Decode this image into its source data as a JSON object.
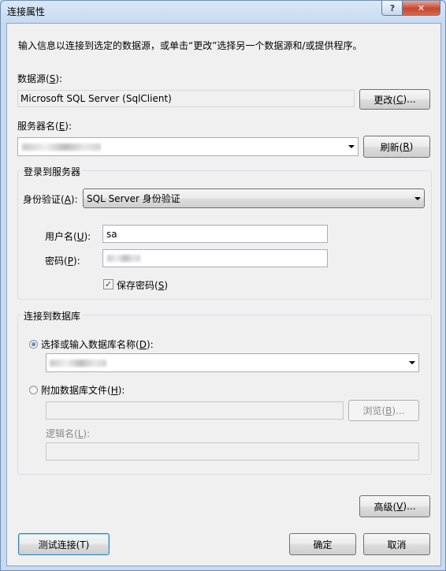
{
  "window": {
    "title": "连接属性",
    "help_label": "?",
    "close_label": "✕"
  },
  "intro_text": "输入信息以连接到选定的数据源，或单击“更改”选择另一个数据源和/或提供程序。",
  "data_source": {
    "label": "数据源(",
    "accel": "S",
    "label_end": "):",
    "value": "Microsoft SQL Server (SqlClient)",
    "change_label": "更改(",
    "change_accel": "C",
    "change_end": ")..."
  },
  "server": {
    "label": "服务器名(",
    "accel": "E",
    "label_end": "):",
    "refresh_label": "刷新(",
    "refresh_accel": "R",
    "refresh_end": ")"
  },
  "login": {
    "group_title": "登录到服务器",
    "auth_label": "身份验证(",
    "auth_accel": "A",
    "auth_end": "):",
    "auth_value": "SQL Server 身份验证",
    "user_label": "用户名(",
    "user_accel": "U",
    "user_end": "):",
    "user_value": "sa",
    "password_label": "密码(",
    "password_accel": "P",
    "password_end": "):",
    "save_password_label": "保存密码(",
    "save_password_accel": "S",
    "save_password_end": ")",
    "save_password_checked": true,
    "check_mark": "✓"
  },
  "database": {
    "group_title": "连接到数据库",
    "select_label": "选择或输入数据库名称(",
    "select_accel": "D",
    "select_end": "):",
    "select_checked": true,
    "attach_label": "附加数据库文件(",
    "attach_accel": "H",
    "attach_end": "):",
    "attach_checked": false,
    "browse_label": "浏览(",
    "browse_accel": "B",
    "browse_end": ")...",
    "logical_label": "逻辑名(",
    "logical_accel": "L",
    "logical_end": "):"
  },
  "buttons": {
    "advanced_label": "高级(",
    "advanced_accel": "V",
    "advanced_end": ")...",
    "test_label": "测试连接(T)",
    "ok_label": "确定",
    "cancel_label": "取消"
  }
}
